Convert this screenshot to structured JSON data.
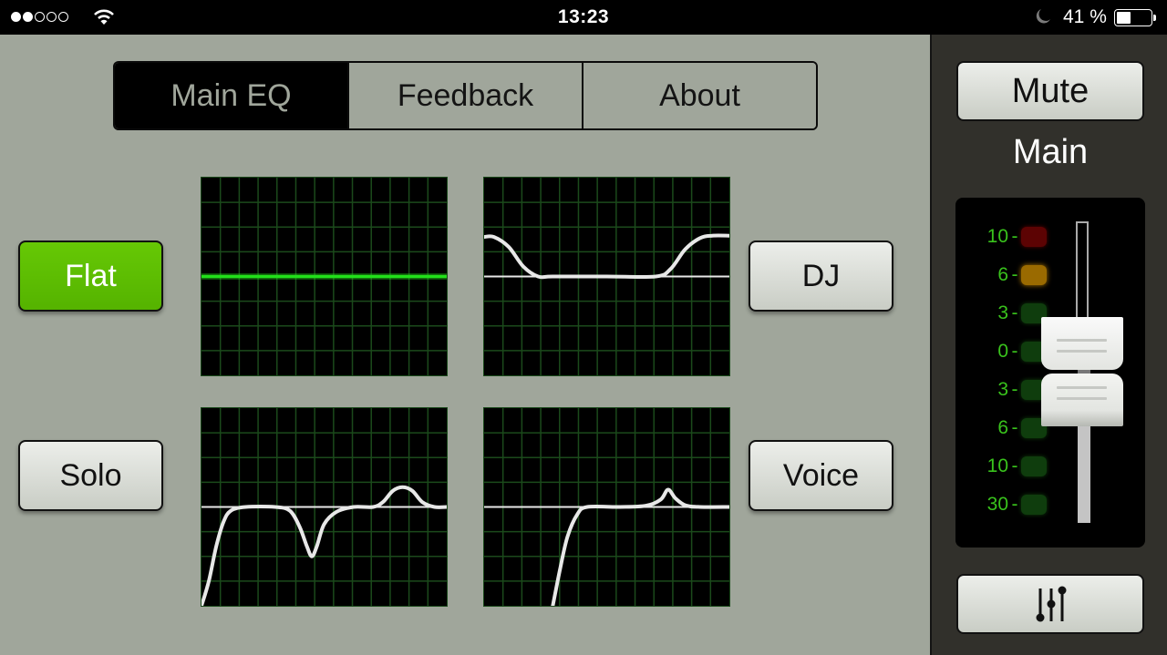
{
  "status_bar": {
    "signal_bars_total": 5,
    "signal_bars_filled": 2,
    "wifi_icon": "wifi-icon",
    "time": "13:23",
    "do_not_disturb_icon": "moon-icon",
    "battery_percent_label": "41 %",
    "battery_level": 0.41
  },
  "tabs": [
    {
      "label": "Main EQ",
      "active": true
    },
    {
      "label": "Feedback",
      "active": false
    },
    {
      "label": "About",
      "active": false
    }
  ],
  "presets": [
    {
      "label": "Flat",
      "active": true,
      "curve_color": "#22e01a",
      "curve": [
        [
          0,
          0
        ],
        [
          1,
          0
        ]
      ]
    },
    {
      "label": "DJ",
      "active": false,
      "curve_color": "#e8e8e8",
      "curve": [
        [
          0,
          1.6
        ],
        [
          0.04,
          1.6
        ],
        [
          0.1,
          1.2
        ],
        [
          0.16,
          0.4
        ],
        [
          0.22,
          0
        ],
        [
          0.28,
          0
        ],
        [
          0.5,
          0
        ],
        [
          0.7,
          0
        ],
        [
          0.76,
          0.3
        ],
        [
          0.82,
          1.1
        ],
        [
          0.88,
          1.55
        ],
        [
          0.93,
          1.65
        ],
        [
          1,
          1.65
        ]
      ]
    },
    {
      "label": "Solo",
      "active": false,
      "curve_color": "#e8e8e8",
      "curve": [
        [
          0,
          -4
        ],
        [
          0.03,
          -3
        ],
        [
          0.06,
          -1.6
        ],
        [
          0.09,
          -0.6
        ],
        [
          0.12,
          -0.15
        ],
        [
          0.18,
          0
        ],
        [
          0.3,
          0
        ],
        [
          0.36,
          -0.15
        ],
        [
          0.4,
          -0.8
        ],
        [
          0.43,
          -1.6
        ],
        [
          0.45,
          -2.0
        ],
        [
          0.47,
          -1.6
        ],
        [
          0.5,
          -0.7
        ],
        [
          0.55,
          -0.2
        ],
        [
          0.62,
          0
        ],
        [
          0.7,
          0
        ],
        [
          0.74,
          0.2
        ],
        [
          0.78,
          0.65
        ],
        [
          0.82,
          0.8
        ],
        [
          0.86,
          0.65
        ],
        [
          0.9,
          0.2
        ],
        [
          0.95,
          0
        ],
        [
          1,
          0
        ]
      ]
    },
    {
      "label": "Voice",
      "active": false,
      "curve_color": "#e8e8e8",
      "curve": [
        [
          0.28,
          -4
        ],
        [
          0.31,
          -2.5
        ],
        [
          0.34,
          -1.2
        ],
        [
          0.38,
          -0.3
        ],
        [
          0.42,
          0
        ],
        [
          0.55,
          0
        ],
        [
          0.66,
          0.05
        ],
        [
          0.72,
          0.3
        ],
        [
          0.75,
          0.7
        ],
        [
          0.78,
          0.35
        ],
        [
          0.82,
          0.07
        ],
        [
          0.88,
          0
        ],
        [
          1,
          0
        ]
      ]
    }
  ],
  "eq_graph": {
    "grid_columns": 13,
    "grid_rows": 8,
    "y_range": [
      -4,
      4
    ],
    "grid_color": "#1b4a1b",
    "zero_line_color": "#e8e8e8"
  },
  "side_panel": {
    "mute_label": "Mute",
    "channel_label": "Main",
    "meter": [
      {
        "label": "10",
        "color": "red"
      },
      {
        "label": "6",
        "color": "amber"
      },
      {
        "label": "3",
        "color": "green"
      },
      {
        "label": "0",
        "color": "green"
      },
      {
        "label": "3",
        "color": "green"
      },
      {
        "label": "6",
        "color": "green"
      },
      {
        "label": "10",
        "color": "green"
      },
      {
        "label": "30",
        "color": "green"
      }
    ],
    "fader_position": 0.45,
    "mixer_icon": "mixer-sliders-icon"
  }
}
